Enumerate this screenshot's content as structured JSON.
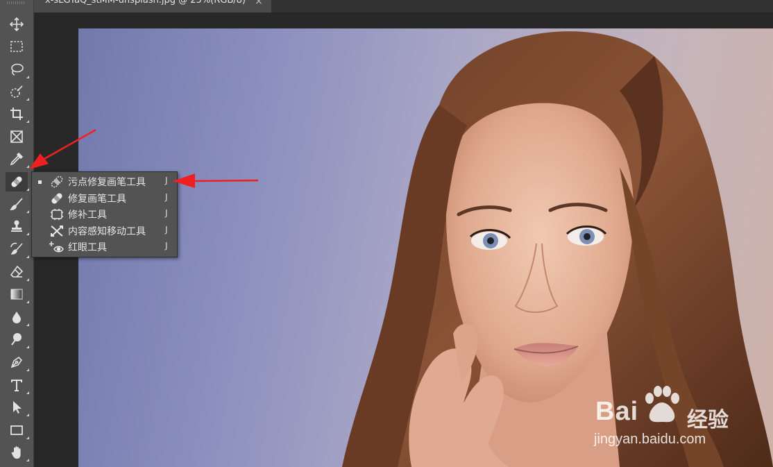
{
  "document": {
    "tab_title": "x-sLGYaQ_stMM-unsplash.jpg @ 25%(RGB/8)",
    "close_glyph": "×"
  },
  "toolbar": {
    "tools": [
      {
        "name": "move-tool",
        "icon": "move-icon"
      },
      {
        "name": "marquee-tool",
        "icon": "rect-marquee-icon"
      },
      {
        "name": "lasso-tool",
        "icon": "lasso-icon"
      },
      {
        "name": "quick-selection-tool",
        "icon": "quick-selection-icon"
      },
      {
        "name": "crop-tool",
        "icon": "crop-icon"
      },
      {
        "name": "frame-tool",
        "icon": "frame-icon"
      },
      {
        "name": "eyedropper-tool",
        "icon": "eyedropper-icon"
      },
      {
        "name": "healing-brush-tool",
        "icon": "bandage-icon",
        "active": true
      },
      {
        "name": "brush-tool",
        "icon": "brush-icon"
      },
      {
        "name": "clone-stamp-tool",
        "icon": "stamp-icon"
      },
      {
        "name": "history-brush-tool",
        "icon": "history-brush-icon"
      },
      {
        "name": "eraser-tool",
        "icon": "eraser-icon"
      },
      {
        "name": "gradient-tool",
        "icon": "gradient-icon"
      },
      {
        "name": "blur-tool",
        "icon": "drop-icon"
      },
      {
        "name": "dodge-tool",
        "icon": "dodge-icon"
      },
      {
        "name": "pen-tool",
        "icon": "pen-icon"
      },
      {
        "name": "type-tool",
        "icon": "type-icon"
      },
      {
        "name": "path-selection-tool",
        "icon": "arrow-icon"
      },
      {
        "name": "rectangle-tool",
        "icon": "rectangle-icon"
      },
      {
        "name": "hand-tool",
        "icon": "hand-icon"
      }
    ]
  },
  "flyout": {
    "items": [
      {
        "label": "污点修复画笔工具",
        "shortcut": "J",
        "icon": "spot-healing-icon",
        "selected": true
      },
      {
        "label": "修复画笔工具",
        "shortcut": "J",
        "icon": "healing-brush-icon",
        "selected": false
      },
      {
        "label": "修补工具",
        "shortcut": "J",
        "icon": "patch-icon",
        "selected": false
      },
      {
        "label": "内容感知移动工具",
        "shortcut": "J",
        "icon": "content-aware-move-icon",
        "selected": false
      },
      {
        "label": "红眼工具",
        "shortcut": "J",
        "icon": "red-eye-icon",
        "selected": false
      }
    ]
  },
  "watermark": {
    "brand": "Bai",
    "brand_suffix": "经验",
    "url": "jingyan.baidu.com"
  },
  "colors": {
    "annotation_arrow": "#f02020",
    "toolbar_bg": "#535353",
    "app_bg": "#282828"
  }
}
